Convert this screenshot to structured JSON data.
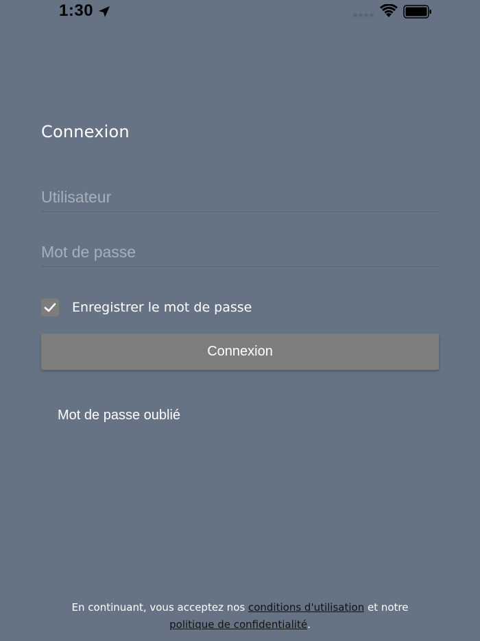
{
  "status_bar": {
    "time": "1:30",
    "location_icon": "location-arrow-icon",
    "signal_icon": "cellular-signal-icon",
    "wifi_icon": "wifi-icon",
    "battery_icon": "battery-icon"
  },
  "title": "Connexion",
  "username": {
    "value": "",
    "placeholder": "Utilisateur"
  },
  "password": {
    "value": "",
    "placeholder": "Mot de passe"
  },
  "remember": {
    "label": "Enregistrer le mot de passe",
    "checked": true,
    "icon": "checkmark-icon"
  },
  "login_button": {
    "label": "Connexion"
  },
  "forgot_link": {
    "label": "Mot de passe oublié"
  },
  "legal": {
    "prefix": "En continuant, vous acceptez nos ",
    "terms_link": "conditions d'utilisation",
    "middle": " et notre",
    "privacy_link": "politique de confidentialité",
    "suffix": "."
  },
  "colors": {
    "background": "#667385",
    "button": "#7e7e7e",
    "link": "#111111"
  }
}
